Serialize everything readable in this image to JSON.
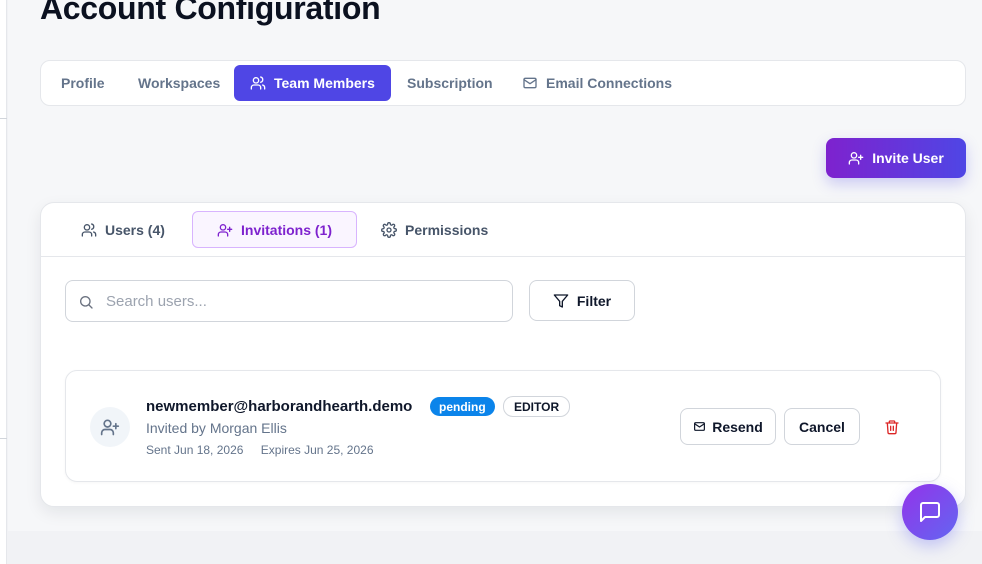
{
  "page": {
    "title": "Account Configuration"
  },
  "top_tabs": [
    {
      "label": "Profile",
      "active": false
    },
    {
      "label": "Workspaces",
      "active": false
    },
    {
      "label": "Team Members",
      "active": true,
      "icon": "users-icon"
    },
    {
      "label": "Subscription",
      "active": false
    },
    {
      "label": "Email Connections",
      "active": false,
      "icon": "mail-icon"
    }
  ],
  "actions": {
    "invite_user_label": "Invite User"
  },
  "sub_tabs": [
    {
      "label": "Users (4)",
      "icon": "users-icon",
      "active": false
    },
    {
      "label": "Invitations (1)",
      "icon": "user-plus-icon",
      "active": true
    },
    {
      "label": "Permissions",
      "icon": "gear-icon",
      "active": false
    }
  ],
  "search": {
    "placeholder": "Search users...",
    "value": ""
  },
  "filter": {
    "label": "Filter"
  },
  "invitation": {
    "email": "newmember@harborandhearth.demo",
    "status": "pending",
    "role": "EDITOR",
    "invited_by": "Invited by Morgan Ellis",
    "sent": "Sent Jun 18, 2026",
    "expires": "Expires Jun 25, 2026",
    "resend_label": "Resend",
    "cancel_label": "Cancel"
  },
  "colors": {
    "primary": "#4f46e5",
    "accent_purple": "#7e22ce",
    "pending_badge": "#0b84ea",
    "danger": "#dc2626"
  }
}
